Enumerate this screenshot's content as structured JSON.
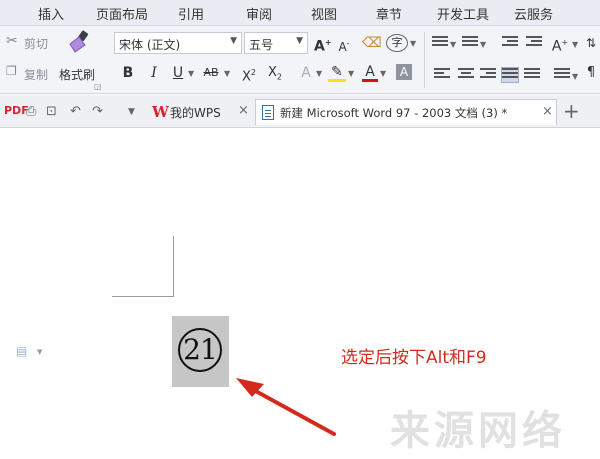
{
  "menu": {
    "items": [
      "插入",
      "页面布局",
      "引用",
      "审阅",
      "视图",
      "章节",
      "开发工具",
      "云服务"
    ]
  },
  "ribbon": {
    "clipboard": {
      "cut": "剪切",
      "copy": "复制",
      "format_painter": "格式刷"
    },
    "font_name": "宋体 (正文)",
    "font_size": "五号"
  },
  "tabs": {
    "wps": "我的WPS",
    "document": "新建 Microsoft Word 97 - 2003 文档 (3) *",
    "close_glyph": "×",
    "new_glyph": "+"
  },
  "document": {
    "selected_content": "21"
  },
  "annotation": {
    "text": "选定后按下Alt和F9",
    "color": "#d42a1e"
  },
  "watermark": {
    "text": "来源网络"
  },
  "colors": {
    "menubar_bg": "#e9ecf2",
    "ribbon_bg": "#f3f4f7",
    "wps_red": "#d6242f",
    "selection_gray": "#c6c6c6"
  },
  "icons": [
    "cut-icon",
    "copy-icon",
    "format-painter-icon",
    "bold-icon",
    "italic-icon",
    "underline-icon",
    "strikethrough-icon",
    "superscript-icon",
    "subscript-icon",
    "font-color-icon",
    "highlight-icon",
    "pdf-icon",
    "print-icon",
    "print-preview-icon",
    "undo-icon",
    "redo-icon",
    "close-icon",
    "new-tab-icon"
  ]
}
